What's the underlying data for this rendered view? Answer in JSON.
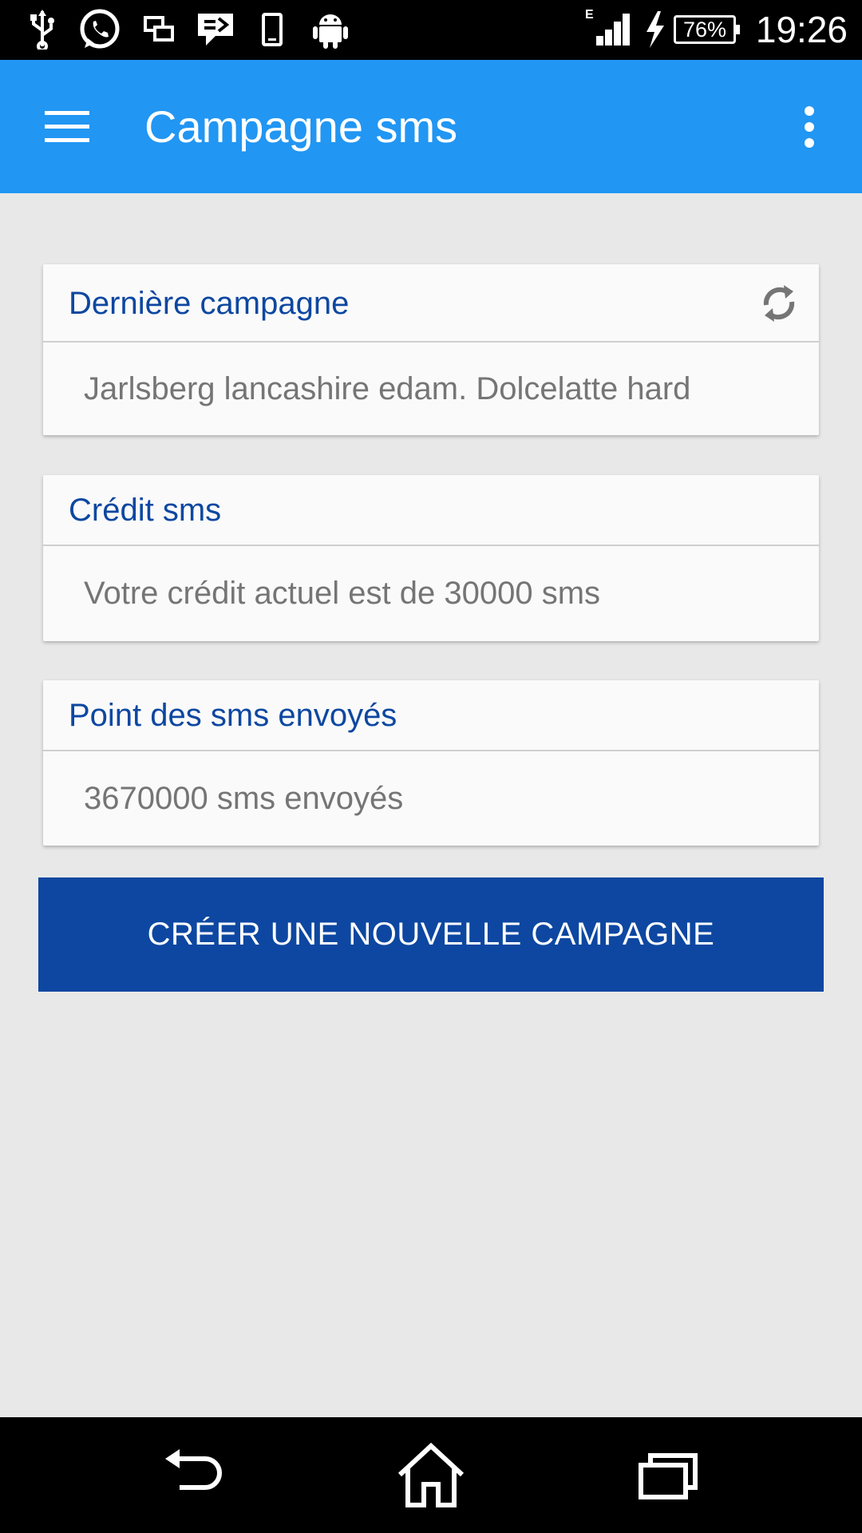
{
  "status_bar": {
    "time": "19:26",
    "battery": "76%",
    "network_type": "E",
    "icons": [
      "usb-icon",
      "whatsapp-icon",
      "screen-mirror-icon",
      "message-icon",
      "phone-icon",
      "android-icon",
      "signal-icon",
      "charging-icon"
    ]
  },
  "app_bar": {
    "title": "Campagne sms",
    "color": "#2196f3"
  },
  "cards": {
    "last_campaign": {
      "title": "Dernière campagne",
      "body": "Jarlsberg lancashire edam. Dolcelatte hard"
    },
    "credit": {
      "title": "Crédit sms",
      "body": "Votre crédit actuel est de 30000 sms"
    },
    "sent": {
      "title": "Point des sms envoyés",
      "body": "3670000 sms envoyés"
    }
  },
  "create_button": {
    "label": "CRÉER UNE NOUVELLE CAMPAGNE",
    "color": "#0d47a1"
  },
  "nav_bar": {
    "icons": [
      "back-icon",
      "home-icon",
      "recent-apps-icon"
    ]
  }
}
